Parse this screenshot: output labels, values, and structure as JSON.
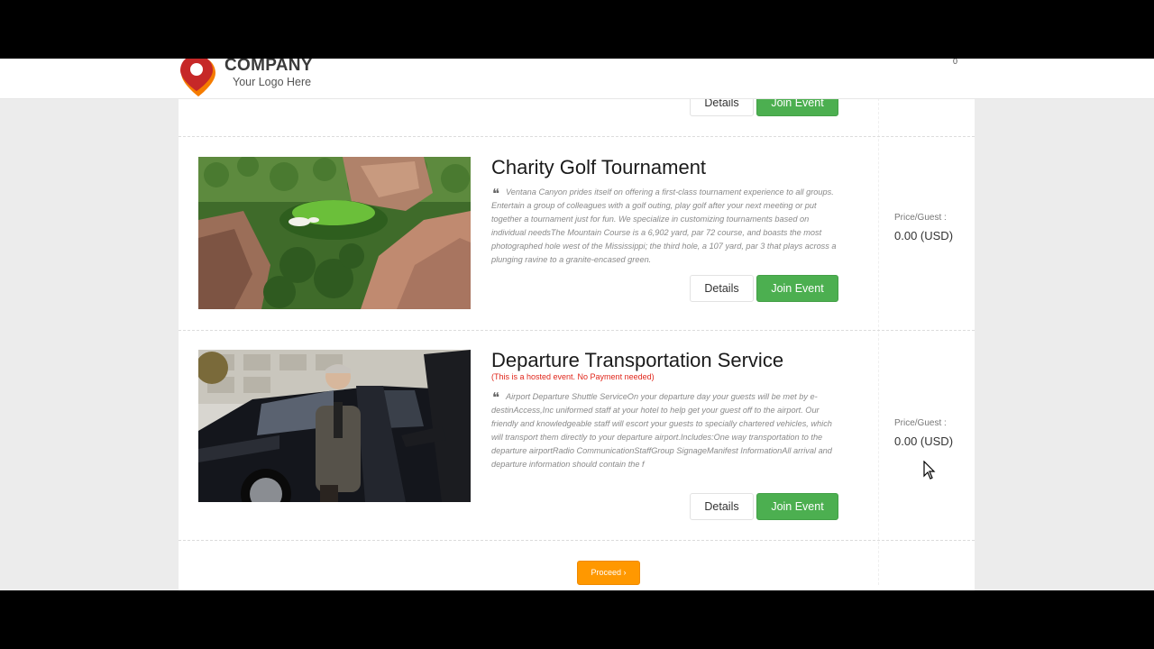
{
  "header": {
    "brand_name": "COMPANY",
    "tagline": "Your Logo Here",
    "cart_count": "0"
  },
  "colors": {
    "join_green": "#4caf50",
    "proceed_orange": "#ff9800",
    "hosted_red": "#e0261b",
    "logo_red": "#c62828",
    "logo_orange": "#f57c00"
  },
  "events": [
    {
      "details_label": "Details",
      "join_label": "Join Event"
    },
    {
      "title": "Charity Golf Tournament",
      "description": "Ventana Canyon prides itself on offering a first-class tournament experience to all groups. Entertain a group of colleagues with a golf outing, play golf after your next meeting or put together a tournament just for fun. We specialize in customizing tournaments based on individual needsThe Mountain Course is a 6,902 yard, par 72 course, and boasts the most photographed hole west of the Mississippi; the third hole, a 107 yard, par 3 that plays across a plunging ravine to a granite-encased green.",
      "price_label": "Price/Guest :",
      "price_value": "0.00 (USD)",
      "details_label": "Details",
      "join_label": "Join Event",
      "image_icon": "golf-course-photo"
    },
    {
      "title": "Departure Transportation Service",
      "note": "(This is a hosted event. No Payment needed)",
      "description": "Airport Departure Shuttle ServiceOn your departure day your guests will be met by e-destinAccess,Inc uniformed staff at your hotel to help get your guest off to the airport. Our friendly and knowledgeable staff will escort your guests to specially chartered vehicles, which will transport them directly to your departure airport.Includes:One way transportation to the departure airportRadio CommunicationStaffGroup SignageManifest InformationAll arrival and departure information should contain the f",
      "price_label": "Price/Guest :",
      "price_value": "0.00 (USD)",
      "details_label": "Details",
      "join_label": "Join Event",
      "image_icon": "chauffeur-car-photo"
    }
  ],
  "footer": {
    "proceed_label": "Proceed",
    "proceed_icon": "chevron-right-icon"
  }
}
